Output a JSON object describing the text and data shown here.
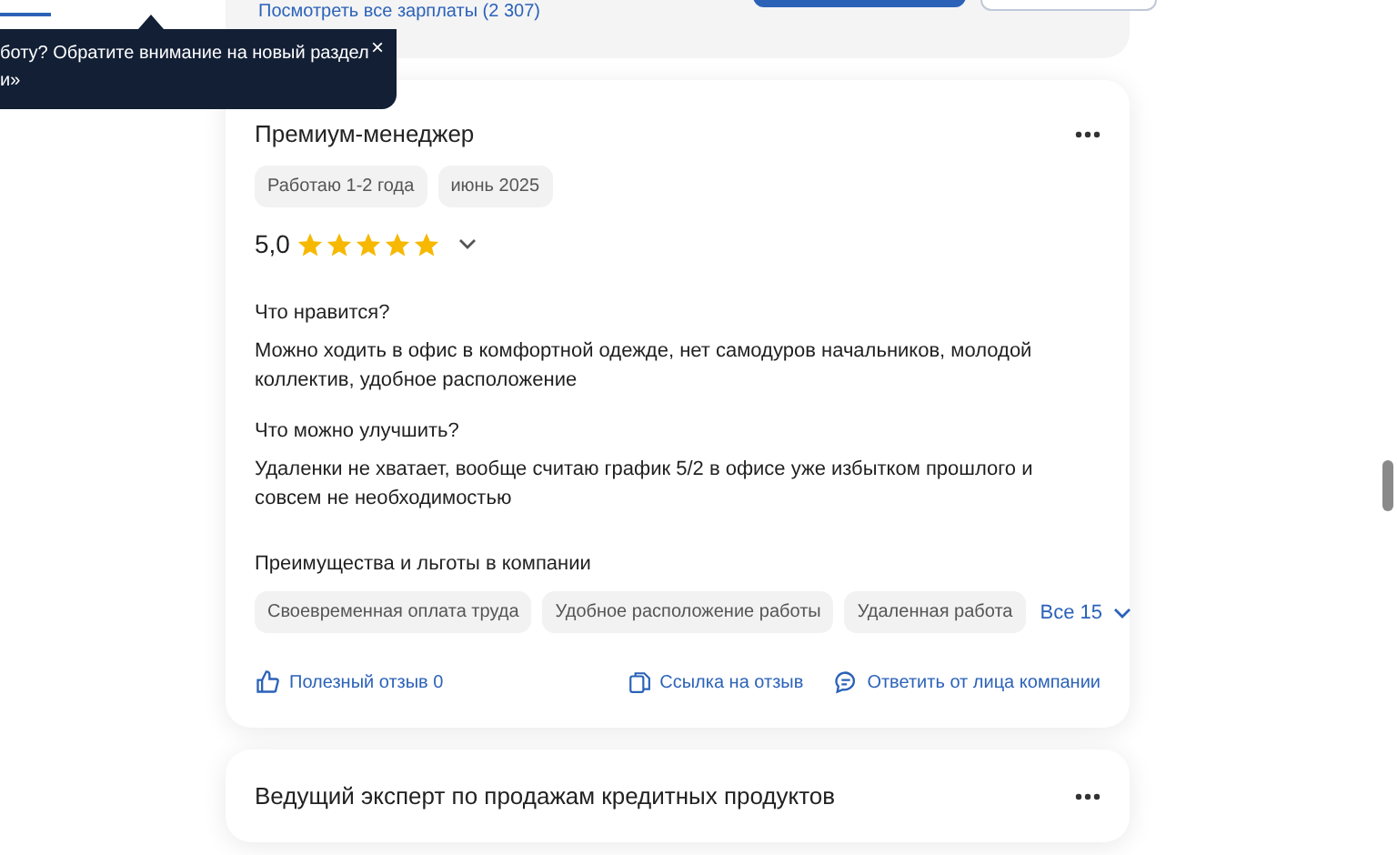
{
  "previous_card": {
    "link": "Посмотреть все зарплаты (2 307)"
  },
  "tooltip": {
    "lines": [
      "боту? Обратите внимание на новый раздел",
      "и»"
    ],
    "close": "×"
  },
  "review": {
    "title": "Премиум-менеджер",
    "tags": [
      "Работаю 1-2 года",
      "июнь 2025"
    ],
    "rating": "5,0",
    "stars": 5,
    "sections": [
      {
        "heading": "Что нравится?",
        "text": "Можно ходить в офис в комфортной одежде, нет самодуров начальников, молодой коллектив, удобное расположение"
      },
      {
        "heading": "Что можно улучшить?",
        "text": "Удаленки не хватает, вообще считаю график 5/2 в офисе уже избытком прошлого и совсем не необходимостью"
      }
    ],
    "benefits": {
      "heading": "Преимущества и льготы в компании",
      "items": [
        "Своевременная оплата труда",
        "Удобное расположение работы",
        "Удаленная работа"
      ],
      "more": "Все 15"
    },
    "actions": {
      "useful": "Полезный отзыв 0",
      "link": "Ссылка на отзыв",
      "reply": "Ответить от лица компании"
    }
  },
  "next_review": {
    "title": "Ведущий эксперт по продажам кредитных продуктов"
  }
}
